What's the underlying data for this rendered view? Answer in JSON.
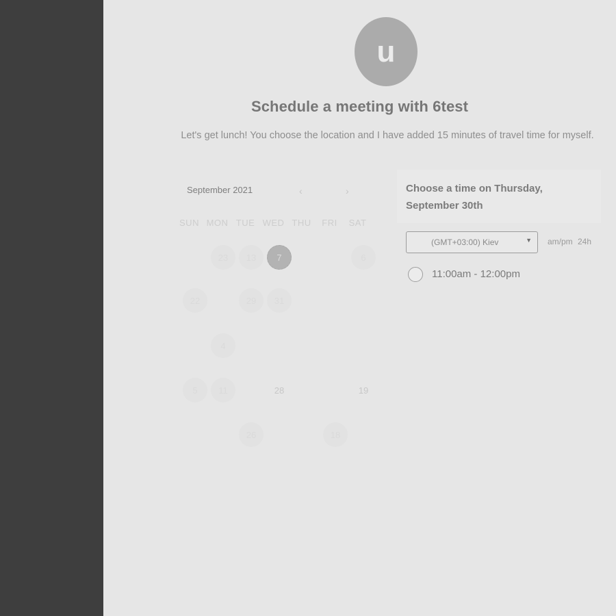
{
  "host": {
    "initial": "u"
  },
  "header": {
    "title": "Schedule a meeting with 6test",
    "description": "Let's get lunch! You choose the location and I have added 15 minutes of travel time for myself."
  },
  "calendar": {
    "month_label": "September 2021",
    "prev_icon": "chevron-left-icon",
    "next_icon": "chevron-right-icon",
    "weekdays": [
      "SUN",
      "MON",
      "TUE",
      "WED",
      "THU",
      "FRI",
      "SAT"
    ],
    "days": [
      "23",
      "13",
      "7",
      "6",
      "22",
      "29",
      "31",
      "4",
      "5",
      "11",
      "28",
      "19",
      "26",
      "18"
    ],
    "selected_day": "7"
  },
  "times": {
    "heading": "Choose a time on Thursday, September 30th",
    "timezone": "(GMT+03:00) Kiev",
    "timezone_caret_icon": "caret-down-icon",
    "format_options": [
      "am/pm",
      "24h"
    ],
    "slots": [
      "11:00am - 12:00pm"
    ]
  },
  "colors": {
    "sidebar": "#3e3e3e",
    "background": "#e6e6e6",
    "avatar": "#ababab"
  }
}
